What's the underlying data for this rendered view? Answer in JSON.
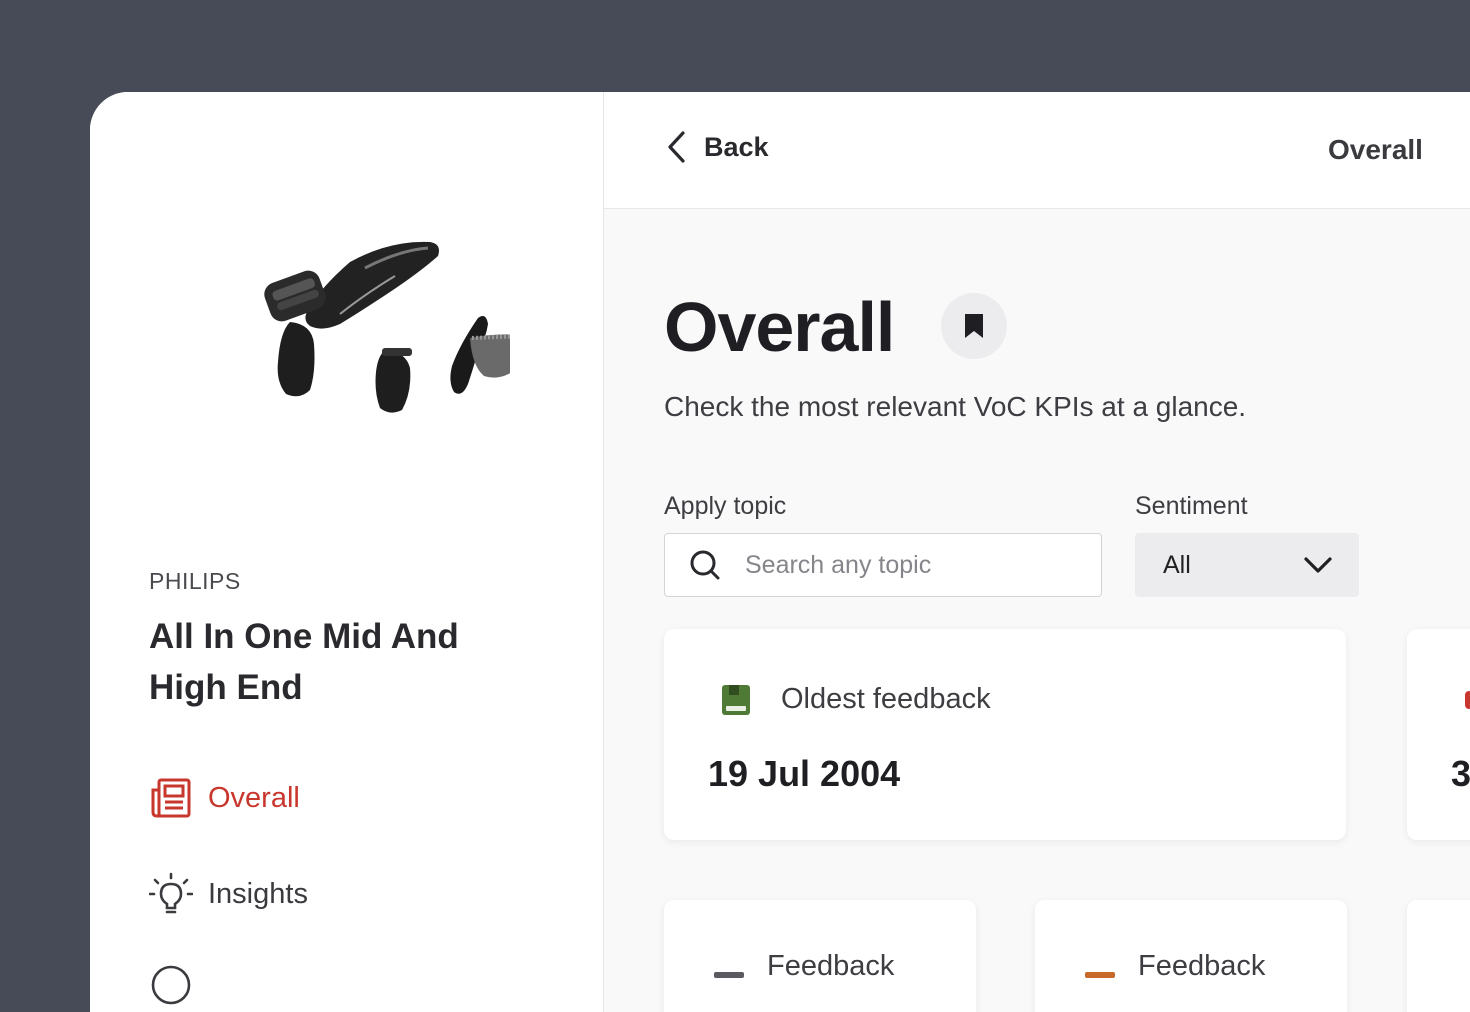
{
  "sidebar": {
    "brand": "PHILIPS",
    "product_name": "All In One Mid And High End",
    "nav": [
      {
        "label": "Overall",
        "icon": "newspaper-icon",
        "active": true
      },
      {
        "label": "Insights",
        "icon": "lightbulb-icon",
        "active": false
      },
      {
        "label": "",
        "icon": "circle-icon",
        "active": false
      }
    ]
  },
  "topbar": {
    "back_label": "Back",
    "title": "Overall"
  },
  "main": {
    "title": "Overall",
    "subtitle": "Check the most relevant VoC KPIs at a glance.",
    "filters": {
      "topic_label": "Apply topic",
      "topic_placeholder": "Search any topic",
      "sentiment_label": "Sentiment",
      "sentiment_value": "All"
    },
    "cards": [
      {
        "label": "Oldest feedback",
        "icon": "book-icon",
        "value": "19 Jul 2004"
      },
      {
        "label": "",
        "value": "3"
      }
    ],
    "bottom_cards": [
      {
        "label": "Feedback"
      },
      {
        "label": "Feedback"
      }
    ]
  },
  "colors": {
    "accent": "#c8372d",
    "book_icon": "#4e7a35",
    "feedback_bar_1": "#5a5a60",
    "feedback_bar_2": "#c66a2c"
  }
}
